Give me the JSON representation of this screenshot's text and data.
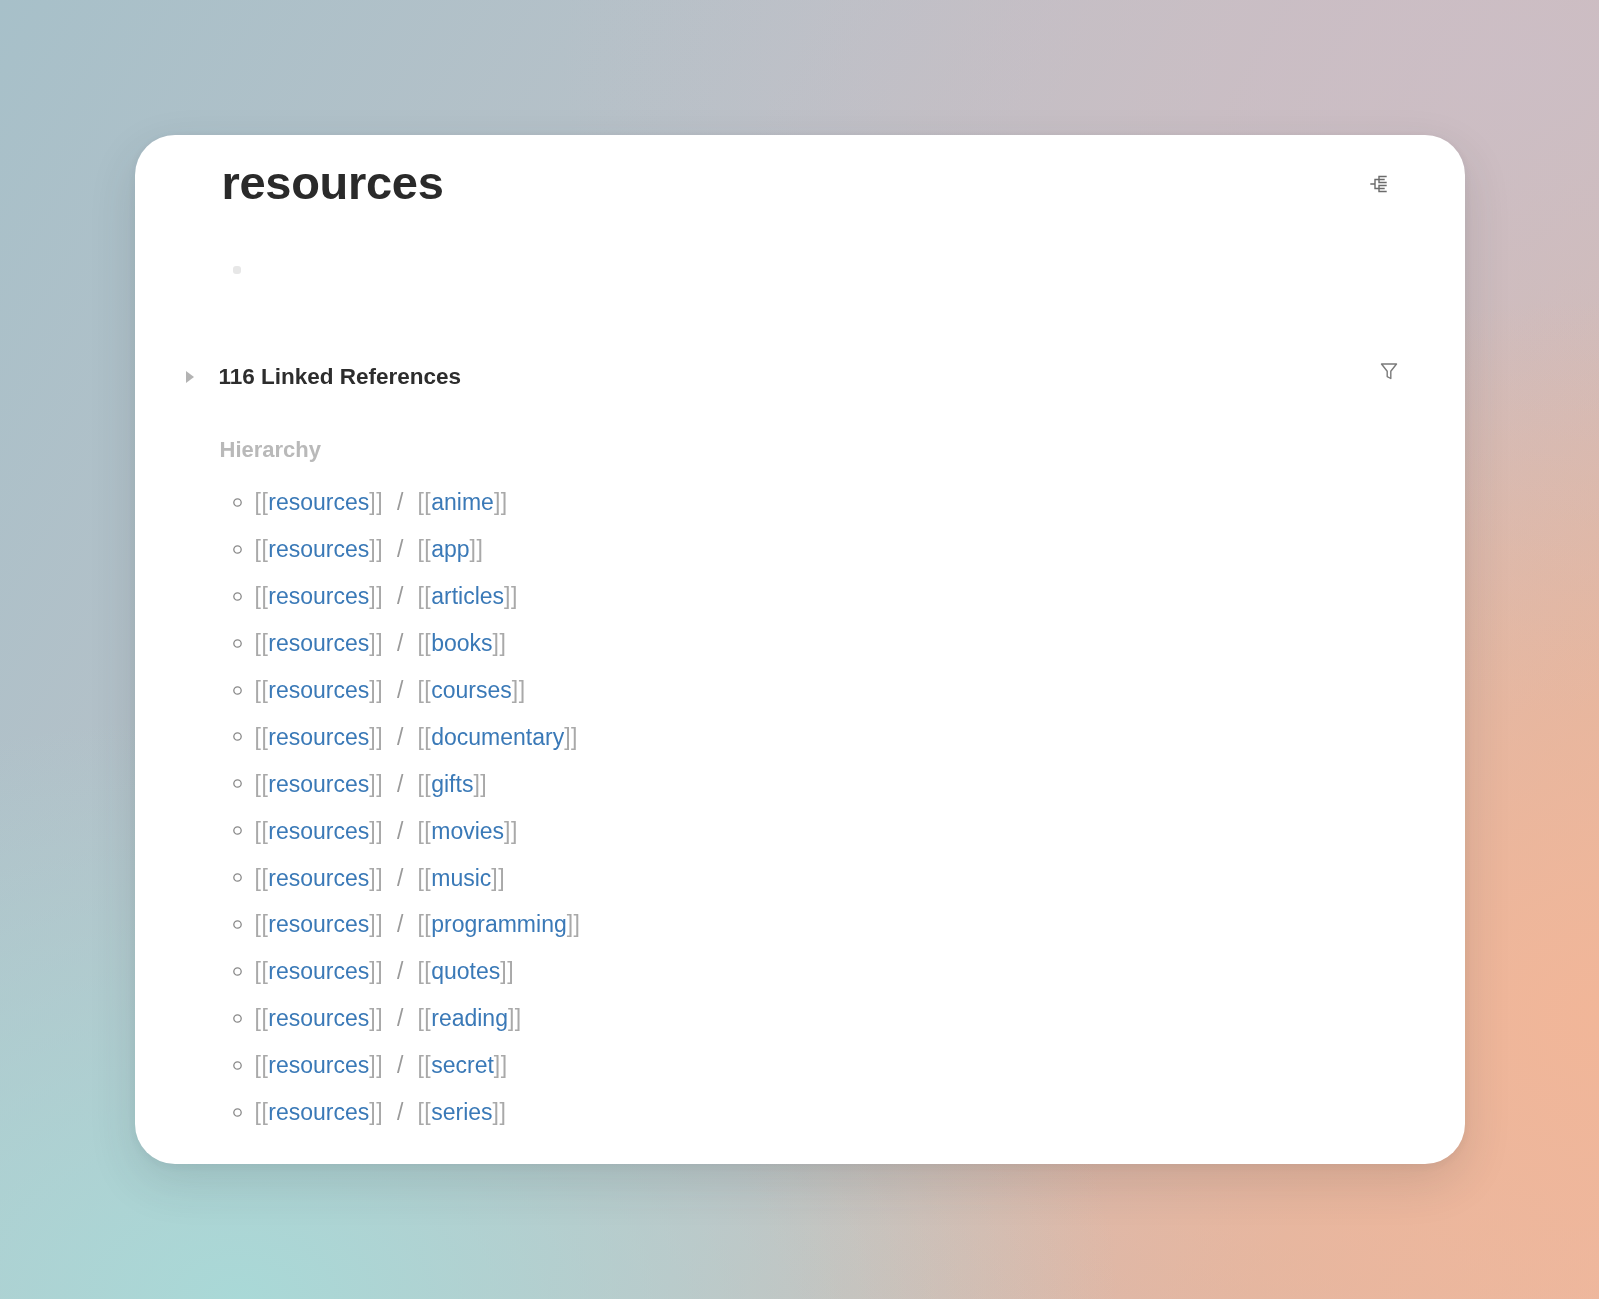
{
  "page": {
    "title": "resources"
  },
  "linked_references": {
    "label": "116 Linked References",
    "expanded": false
  },
  "hierarchy": {
    "title": "Hierarchy",
    "items": [
      {
        "parent": {
          "open": "[[",
          "name": "resources",
          "close": "]]"
        },
        "separator": "/",
        "child": {
          "open": "[[",
          "name": "anime",
          "close": "]]"
        }
      },
      {
        "parent": {
          "open": "[[",
          "name": "resources",
          "close": "]]"
        },
        "separator": "/",
        "child": {
          "open": "[[",
          "name": "app",
          "close": "]]"
        }
      },
      {
        "parent": {
          "open": "[[",
          "name": "resources",
          "close": "]]"
        },
        "separator": "/",
        "child": {
          "open": "[[",
          "name": "articles",
          "close": "]]"
        }
      },
      {
        "parent": {
          "open": "[[",
          "name": "resources",
          "close": "]]"
        },
        "separator": "/",
        "child": {
          "open": "[[",
          "name": "books",
          "close": "]]"
        }
      },
      {
        "parent": {
          "open": "[[",
          "name": "resources",
          "close": "]]"
        },
        "separator": "/",
        "child": {
          "open": "[[",
          "name": "courses",
          "close": "]]"
        }
      },
      {
        "parent": {
          "open": "[[",
          "name": "resources",
          "close": "]]"
        },
        "separator": "/",
        "child": {
          "open": "[[",
          "name": "documentary",
          "close": "]]"
        }
      },
      {
        "parent": {
          "open": "[[",
          "name": "resources",
          "close": "]]"
        },
        "separator": "/",
        "child": {
          "open": "[[",
          "name": "gifts",
          "close": "]]"
        }
      },
      {
        "parent": {
          "open": "[[",
          "name": "resources",
          "close": "]]"
        },
        "separator": "/",
        "child": {
          "open": "[[",
          "name": "movies",
          "close": "]]"
        }
      },
      {
        "parent": {
          "open": "[[",
          "name": "resources",
          "close": "]]"
        },
        "separator": "/",
        "child": {
          "open": "[[",
          "name": "music",
          "close": "]]"
        }
      },
      {
        "parent": {
          "open": "[[",
          "name": "resources",
          "close": "]]"
        },
        "separator": "/",
        "child": {
          "open": "[[",
          "name": "programming",
          "close": "]]"
        }
      },
      {
        "parent": {
          "open": "[[",
          "name": "resources",
          "close": "]]"
        },
        "separator": "/",
        "child": {
          "open": "[[",
          "name": "quotes",
          "close": "]]"
        }
      },
      {
        "parent": {
          "open": "[[",
          "name": "resources",
          "close": "]]"
        },
        "separator": "/",
        "child": {
          "open": "[[",
          "name": "reading",
          "close": "]]"
        }
      },
      {
        "parent": {
          "open": "[[",
          "name": "resources",
          "close": "]]"
        },
        "separator": "/",
        "child": {
          "open": "[[",
          "name": "secret",
          "close": "]]"
        }
      },
      {
        "parent": {
          "open": "[[",
          "name": "resources",
          "close": "]]"
        },
        "separator": "/",
        "child": {
          "open": "[[",
          "name": "series",
          "close": "]]"
        }
      }
    ]
  }
}
